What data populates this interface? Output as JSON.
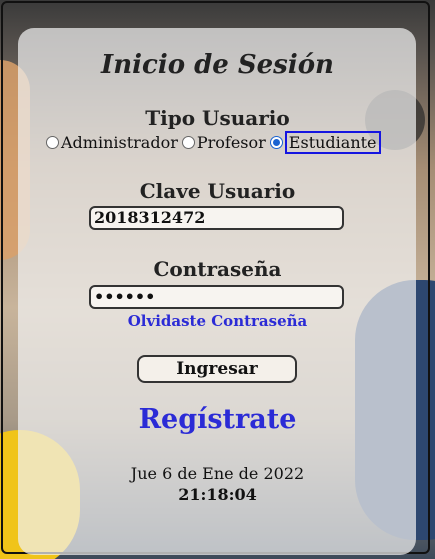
{
  "form": {
    "title": "Inicio de Sesión",
    "user_type_label": "Tipo Usuario",
    "user_types": [
      {
        "label": "Administrador",
        "checked": false
      },
      {
        "label": "Profesor",
        "checked": false
      },
      {
        "label": "Estudiante",
        "checked": true
      }
    ],
    "user_key_label": "Clave Usuario",
    "user_key_value": "2018312472",
    "password_label": "Contraseña",
    "password_value": "••••••",
    "forgot_password": "Olvidaste Contraseña",
    "submit_label": "Ingresar",
    "register_link": "Regístrate"
  },
  "clock": {
    "date": "Jue 6 de Ene de 2022",
    "time": "21:18:04"
  },
  "colors": {
    "link": "#2b2bd6",
    "radio_selected": "#1a63d1"
  }
}
